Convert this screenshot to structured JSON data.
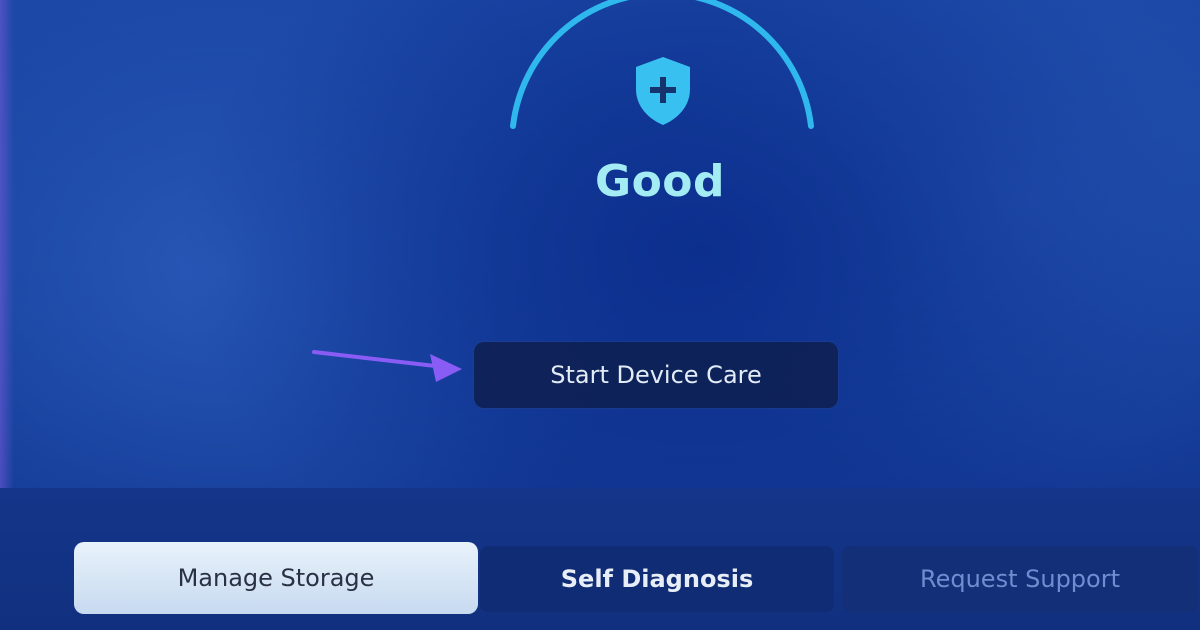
{
  "device_care": {
    "status_label": "Good",
    "status_icon": "shield-plus-icon",
    "start_button_label": "Start Device Care"
  },
  "bottom_menu": {
    "items": [
      {
        "label": "Manage Storage",
        "state": "selected"
      },
      {
        "label": "Self Diagnosis",
        "state": "normal"
      },
      {
        "label": "Request Support",
        "state": "dimmed"
      }
    ]
  },
  "annotation": {
    "arrow_color": "#8a5cf6"
  },
  "colors": {
    "accent_cyan": "#2fb8ee",
    "status_text": "#a4ecf3"
  }
}
